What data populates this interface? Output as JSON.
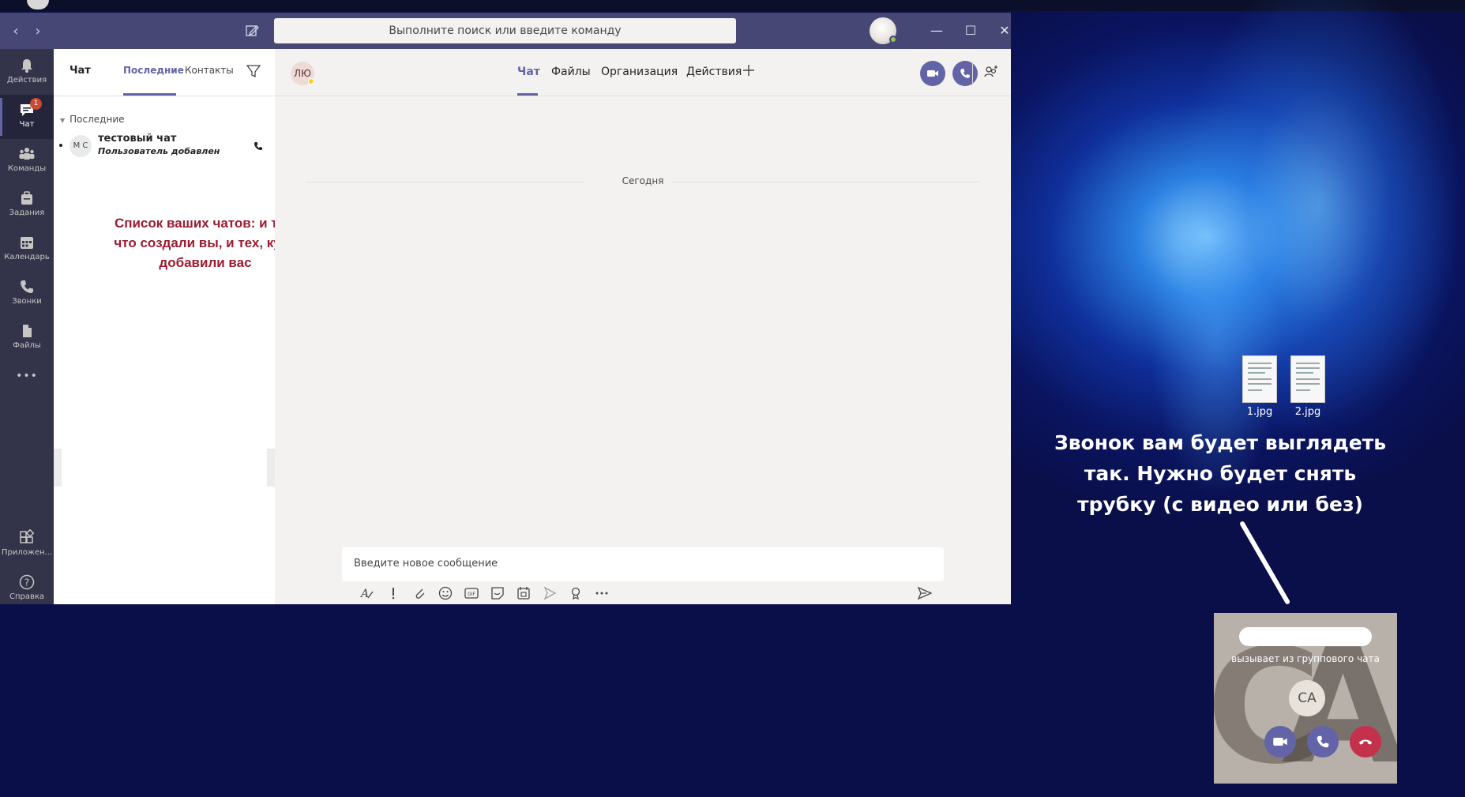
{
  "window": {
    "search_placeholder": "Выполните поиск или введите команду",
    "controls": {
      "minimize": "—",
      "maximize": "☐",
      "close": "✕"
    }
  },
  "rail": {
    "items": [
      {
        "label": "Действия",
        "icon": "bell-icon"
      },
      {
        "label": "Чат",
        "icon": "chat-icon",
        "badge": "1"
      },
      {
        "label": "Команды",
        "icon": "teams-icon"
      },
      {
        "label": "Задания",
        "icon": "assignments-icon"
      },
      {
        "label": "Календарь",
        "icon": "calendar-icon"
      },
      {
        "label": "Звонки",
        "icon": "phone-icon"
      },
      {
        "label": "Файлы",
        "icon": "files-icon"
      },
      {
        "label": "•••",
        "icon": "more-icon"
      },
      {
        "label": "Приложен...",
        "icon": "apps-icon"
      },
      {
        "label": "Справка",
        "icon": "help-icon"
      }
    ]
  },
  "chatlist": {
    "title": "Чат",
    "tabs": [
      "Последние",
      "Контакты"
    ],
    "section": "Последние",
    "items": [
      {
        "avatar": "М С",
        "name": "тестовый чат",
        "preview": "Пользователь добавлен"
      }
    ],
    "annotation": "Список ваших чатов: и тех, что создали вы, и тех, куда добавили вас"
  },
  "main": {
    "avatar_initials": "ЛЮ",
    "tabs": [
      "Чат",
      "Файлы",
      "Организация",
      "Действия"
    ],
    "add_tab": "+",
    "date_divider": "Сегодня",
    "compose_placeholder": "Введите новое сообщение"
  },
  "desktop": {
    "files": [
      "1.jpg",
      "2.jpg"
    ],
    "annotation": "Звонок вам будет выглядеть так. Нужно будет снять трубку (с видео или без)"
  },
  "call_popup": {
    "subtitle": "вызывает из группового чата",
    "avatar": "CA",
    "accent_video": "#6264a7",
    "accent_decline": "#c4314b"
  }
}
